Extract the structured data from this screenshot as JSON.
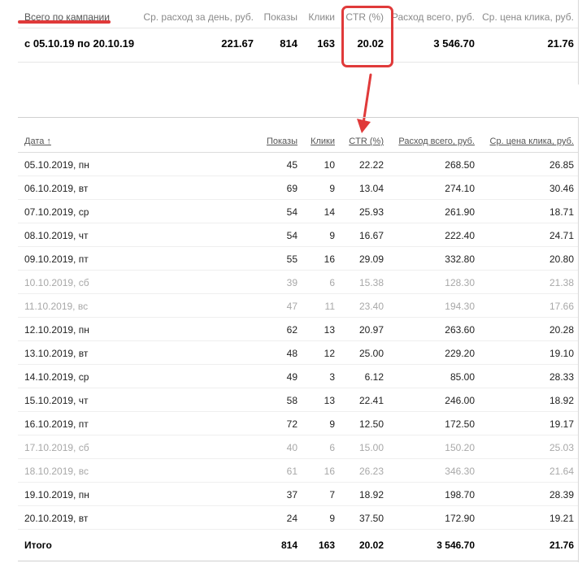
{
  "summary": {
    "headers": {
      "campaign": "Всего по кампании",
      "avg_daily": "Ср. расход за день, руб.",
      "impressions": "Показы",
      "clicks": "Клики",
      "ctr": "CTR (%)",
      "total_spend": "Расход всего, руб.",
      "avg_cpc": "Ср. цена клика, руб."
    },
    "values": {
      "period": "с 05.10.19 по 20.10.19",
      "avg_daily": "221.67",
      "impressions": "814",
      "clicks": "163",
      "ctr": "20.02",
      "total_spend": "3 546.70",
      "avg_cpc": "21.76"
    }
  },
  "annotation_color": "#e03a3a",
  "table": {
    "headers": {
      "date": "Дата ↑",
      "impressions": "Показы",
      "clicks": "Клики",
      "ctr": "CTR (%)",
      "spend": "Расход всего, руб.",
      "cpc": "Ср. цена клика, руб."
    },
    "rows": [
      {
        "date": "05.10.2019, пн",
        "impressions": "45",
        "clicks": "10",
        "ctr": "22.22",
        "spend": "268.50",
        "cpc": "26.85",
        "weekend": false
      },
      {
        "date": "06.10.2019, вт",
        "impressions": "69",
        "clicks": "9",
        "ctr": "13.04",
        "spend": "274.10",
        "cpc": "30.46",
        "weekend": false
      },
      {
        "date": "07.10.2019, ср",
        "impressions": "54",
        "clicks": "14",
        "ctr": "25.93",
        "spend": "261.90",
        "cpc": "18.71",
        "weekend": false
      },
      {
        "date": "08.10.2019, чт",
        "impressions": "54",
        "clicks": "9",
        "ctr": "16.67",
        "spend": "222.40",
        "cpc": "24.71",
        "weekend": false
      },
      {
        "date": "09.10.2019, пт",
        "impressions": "55",
        "clicks": "16",
        "ctr": "29.09",
        "spend": "332.80",
        "cpc": "20.80",
        "weekend": false
      },
      {
        "date": "10.10.2019, сб",
        "impressions": "39",
        "clicks": "6",
        "ctr": "15.38",
        "spend": "128.30",
        "cpc": "21.38",
        "weekend": true
      },
      {
        "date": "11.10.2019, вс",
        "impressions": "47",
        "clicks": "11",
        "ctr": "23.40",
        "spend": "194.30",
        "cpc": "17.66",
        "weekend": true
      },
      {
        "date": "12.10.2019, пн",
        "impressions": "62",
        "clicks": "13",
        "ctr": "20.97",
        "spend": "263.60",
        "cpc": "20.28",
        "weekend": false
      },
      {
        "date": "13.10.2019, вт",
        "impressions": "48",
        "clicks": "12",
        "ctr": "25.00",
        "spend": "229.20",
        "cpc": "19.10",
        "weekend": false
      },
      {
        "date": "14.10.2019, ср",
        "impressions": "49",
        "clicks": "3",
        "ctr": "6.12",
        "spend": "85.00",
        "cpc": "28.33",
        "weekend": false
      },
      {
        "date": "15.10.2019, чт",
        "impressions": "58",
        "clicks": "13",
        "ctr": "22.41",
        "spend": "246.00",
        "cpc": "18.92",
        "weekend": false
      },
      {
        "date": "16.10.2019, пт",
        "impressions": "72",
        "clicks": "9",
        "ctr": "12.50",
        "spend": "172.50",
        "cpc": "19.17",
        "weekend": false
      },
      {
        "date": "17.10.2019, сб",
        "impressions": "40",
        "clicks": "6",
        "ctr": "15.00",
        "spend": "150.20",
        "cpc": "25.03",
        "weekend": true
      },
      {
        "date": "18.10.2019, вс",
        "impressions": "61",
        "clicks": "16",
        "ctr": "26.23",
        "spend": "346.30",
        "cpc": "21.64",
        "weekend": true
      },
      {
        "date": "19.10.2019, пн",
        "impressions": "37",
        "clicks": "7",
        "ctr": "18.92",
        "spend": "198.70",
        "cpc": "28.39",
        "weekend": false
      },
      {
        "date": "20.10.2019, вт",
        "impressions": "24",
        "clicks": "9",
        "ctr": "37.50",
        "spend": "172.90",
        "cpc": "19.21",
        "weekend": false
      }
    ],
    "total": {
      "label": "Итого",
      "impressions": "814",
      "clicks": "163",
      "ctr": "20.02",
      "spend": "3 546.70",
      "cpc": "21.76"
    }
  }
}
